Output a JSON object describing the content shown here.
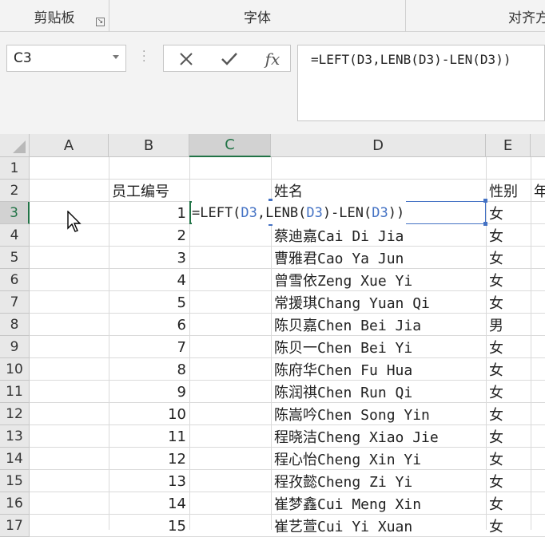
{
  "ribbon": {
    "groups": [
      "剪贴板",
      "字体",
      "对齐方"
    ]
  },
  "name_box": {
    "value": "C3"
  },
  "formula_bar": {
    "cancel_icon": "close-icon",
    "enter_icon": "check-icon",
    "fx_label": "fx",
    "formula": "=LEFT(D3,LENB(D3)-LEN(D3))"
  },
  "columns": [
    "A",
    "B",
    "C",
    "D",
    "E"
  ],
  "rows": [
    "1",
    "2",
    "3",
    "4",
    "5",
    "6",
    "7",
    "8",
    "9",
    "10",
    "11",
    "12",
    "13",
    "14",
    "15",
    "16",
    "17"
  ],
  "headers": {
    "b": "员工编号",
    "d": "姓名",
    "e": "性别",
    "f": "年"
  },
  "editing": {
    "parts": [
      "=LEFT(",
      "D3",
      ",LENB(",
      "D3",
      ")-LEN(",
      "D3",
      "))"
    ]
  },
  "data_rows": [
    {
      "b": "1",
      "d": "",
      "e": "女"
    },
    {
      "b": "2",
      "d": "蔡迪嘉Cai Di Jia",
      "e": "女"
    },
    {
      "b": "3",
      "d": "曹雅君Cao Ya Jun",
      "e": "女"
    },
    {
      "b": "4",
      "d": "曾雪依Zeng Xue Yi",
      "e": "女"
    },
    {
      "b": "5",
      "d": "常援琪Chang Yuan Qi",
      "e": "女"
    },
    {
      "b": "6",
      "d": "陈贝嘉Chen Bei Jia",
      "e": "男"
    },
    {
      "b": "7",
      "d": "陈贝一Chen Bei Yi",
      "e": "女"
    },
    {
      "b": "8",
      "d": "陈府华Chen Fu Hua",
      "e": "女"
    },
    {
      "b": "9",
      "d": "陈润祺Chen Run Qi",
      "e": "女"
    },
    {
      "b": "10",
      "d": "陈嵩吟Chen Song Yin",
      "e": "女"
    },
    {
      "b": "11",
      "d": "程晓洁Cheng Xiao Jie",
      "e": "女"
    },
    {
      "b": "12",
      "d": "程心怡Cheng Xin Yi",
      "e": "女"
    },
    {
      "b": "13",
      "d": "程孜懿Cheng Zi Yi",
      "e": "女"
    },
    {
      "b": "14",
      "d": "崔梦鑫Cui Meng Xin",
      "e": "女"
    },
    {
      "b": "15",
      "d": "崔艺萱Cui Yi Xuan",
      "e": "女"
    }
  ]
}
